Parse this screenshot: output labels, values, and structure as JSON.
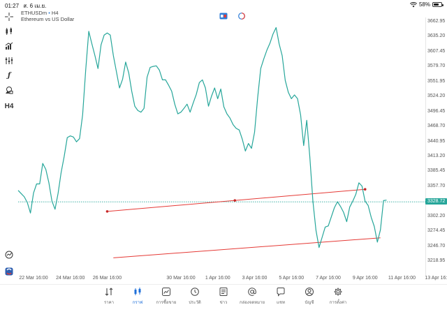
{
  "status": {
    "time": "01:27",
    "date": "ส. 6 เม.ย.",
    "battery": "58%"
  },
  "symbol": {
    "ticker": "ETHUSDm",
    "timeframe": "H4",
    "name": "Ethereum vs US Dollar"
  },
  "toolbar": [
    {
      "icon": "crosshair-icon"
    },
    {
      "icon": "chart-type-icon"
    },
    {
      "icon": "indicators-icon"
    },
    {
      "icon": "objects-icon"
    },
    {
      "icon": "function-icon"
    },
    {
      "icon": "shapes-icon"
    },
    {
      "icon": "timeframe-label",
      "label": "H4"
    }
  ],
  "current_price": "3328.72",
  "colors": {
    "line": "#26a69a",
    "trendline": "#e53935",
    "accent": "#1e6fd9"
  },
  "chart_data": {
    "type": "line",
    "title": "ETHUSDm • H4",
    "subtitle": "Ethereum vs US Dollar",
    "xlabel": "",
    "ylabel": "",
    "ylim": [
      3205,
      3676
    ],
    "y_ticks": [
      "3662.95",
      "3635.20",
      "3607.45",
      "3579.70",
      "3551.95",
      "3524.20",
      "3496.45",
      "3468.70",
      "3440.95",
      "3413.20",
      "3385.45",
      "3357.70",
      "3330.00",
      "3302.20",
      "3274.45",
      "3246.70",
      "3218.95"
    ],
    "x_ticks": [
      "22 Mar 16:00",
      "24 Mar 16:00",
      "26 Mar 16:00",
      "30 Mar 16:00",
      "1 Apr 16:00",
      "3 Apr 16:00",
      "5 Apr 16:00",
      "7 Apr 16:00",
      "9 Apr 16:00",
      "11 Apr 16:00",
      "13 Apr 16:00"
    ],
    "x_start": "21 Mar 20:00",
    "interval_hours": 4,
    "series": [
      {
        "name": "ETHUSDm",
        "values": [
          3350,
          3344,
          3338,
          3327,
          3308,
          3345,
          3362,
          3362,
          3400,
          3389,
          3364,
          3330,
          3315,
          3344,
          3383,
          3413,
          3448,
          3451,
          3449,
          3440,
          3446,
          3490,
          3573,
          3645,
          3622,
          3600,
          3576,
          3620,
          3638,
          3642,
          3638,
          3600,
          3570,
          3540,
          3556,
          3588,
          3568,
          3534,
          3506,
          3498,
          3495,
          3502,
          3560,
          3578,
          3580,
          3581,
          3573,
          3555,
          3555,
          3545,
          3534,
          3510,
          3492,
          3495,
          3502,
          3510,
          3495,
          3512,
          3528,
          3550,
          3555,
          3540,
          3506,
          3525,
          3540,
          3520,
          3538,
          3505,
          3492,
          3484,
          3472,
          3465,
          3462,
          3445,
          3423,
          3437,
          3428,
          3458,
          3522,
          3576,
          3594,
          3610,
          3623,
          3640,
          3652,
          3622,
          3600,
          3554,
          3532,
          3520,
          3527,
          3520,
          3490,
          3433,
          3480,
          3412,
          3330,
          3276,
          3244,
          3263,
          3282,
          3284,
          3301,
          3318,
          3329,
          3320,
          3309,
          3292,
          3319,
          3330,
          3343,
          3364,
          3358,
          3330,
          3322,
          3300,
          3283,
          3254,
          3277,
          3331,
          3332
        ],
        "color": "#26a69a"
      }
    ],
    "trendlines": [
      {
        "from": {
          "x": "26 Mar 16:00",
          "y": 3311
        },
        "to": {
          "x": "9 Apr 16:00",
          "y": 3352
        },
        "color": "#e53935"
      },
      {
        "from": {
          "x": "27 Mar 00:00",
          "y": 3225
        },
        "to": {
          "x": "10 Apr 12:00",
          "y": 3262
        },
        "color": "#e53935"
      }
    ],
    "current_price_line": 3328.72,
    "grid": false,
    "legend": "none"
  },
  "nav": [
    {
      "label": "ราคา",
      "icon": "quotes-icon",
      "active": false
    },
    {
      "label": "กราฟ",
      "icon": "chart-icon",
      "active": true
    },
    {
      "label": "การซื้อขาย",
      "icon": "trade-icon",
      "active": false
    },
    {
      "label": "ประวัติ",
      "icon": "history-icon",
      "active": false
    },
    {
      "label": "ข่าว",
      "icon": "news-icon",
      "active": false
    },
    {
      "label": "กล่องจดหมาย",
      "icon": "mailbox-icon",
      "active": false
    },
    {
      "label": "แชท",
      "icon": "chat-icon",
      "active": false
    },
    {
      "label": "บัญชี",
      "icon": "account-icon",
      "active": false
    },
    {
      "label": "การตั้งค่า",
      "icon": "settings-icon",
      "active": false
    }
  ]
}
